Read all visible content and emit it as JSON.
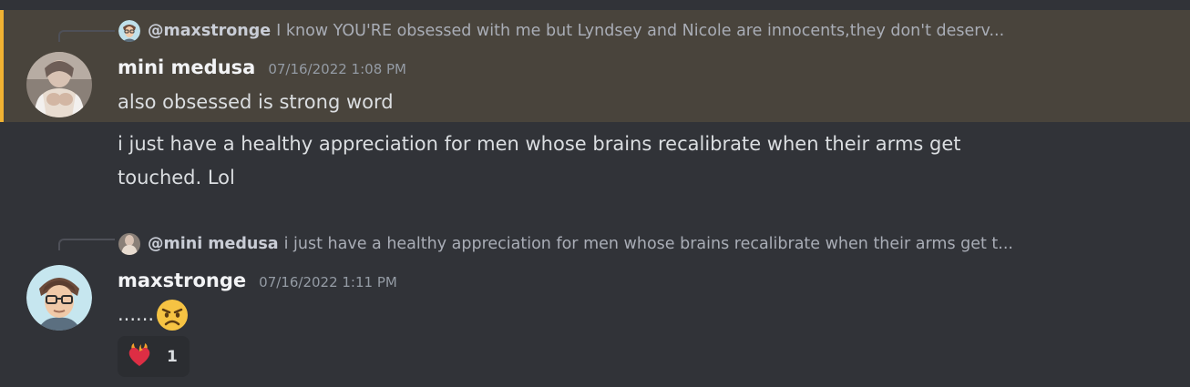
{
  "messages": [
    {
      "reply": {
        "author": "@maxstronge",
        "text": "I know YOU'RE obsessed with me but Lyndsey and Nicole are innocents,they don't deserv..."
      },
      "author": "mini medusa",
      "timestamp": "07/16/2022 1:08 PM",
      "lines": [
        "also obsessed is strong word"
      ]
    },
    {
      "author": "mini medusa",
      "lines": [
        "i just have a healthy appreciation for men whose brains recalibrate when their arms get",
        "touched. Lol"
      ]
    },
    {
      "reply": {
        "author": "@mini medusa",
        "text": "i just have a healthy appreciation for men whose brains recalibrate when their arms get t..."
      },
      "author": "maxstronge",
      "timestamp": "07/16/2022 1:11 PM",
      "text": "......",
      "emoji": "angry-face-emoji",
      "reaction": {
        "emoji": "heart-on-fire-emoji",
        "count": "1"
      }
    }
  ],
  "colors": {
    "background": "#313338",
    "mention_highlight": "#49443c",
    "mention_bar": "#f0b232"
  }
}
